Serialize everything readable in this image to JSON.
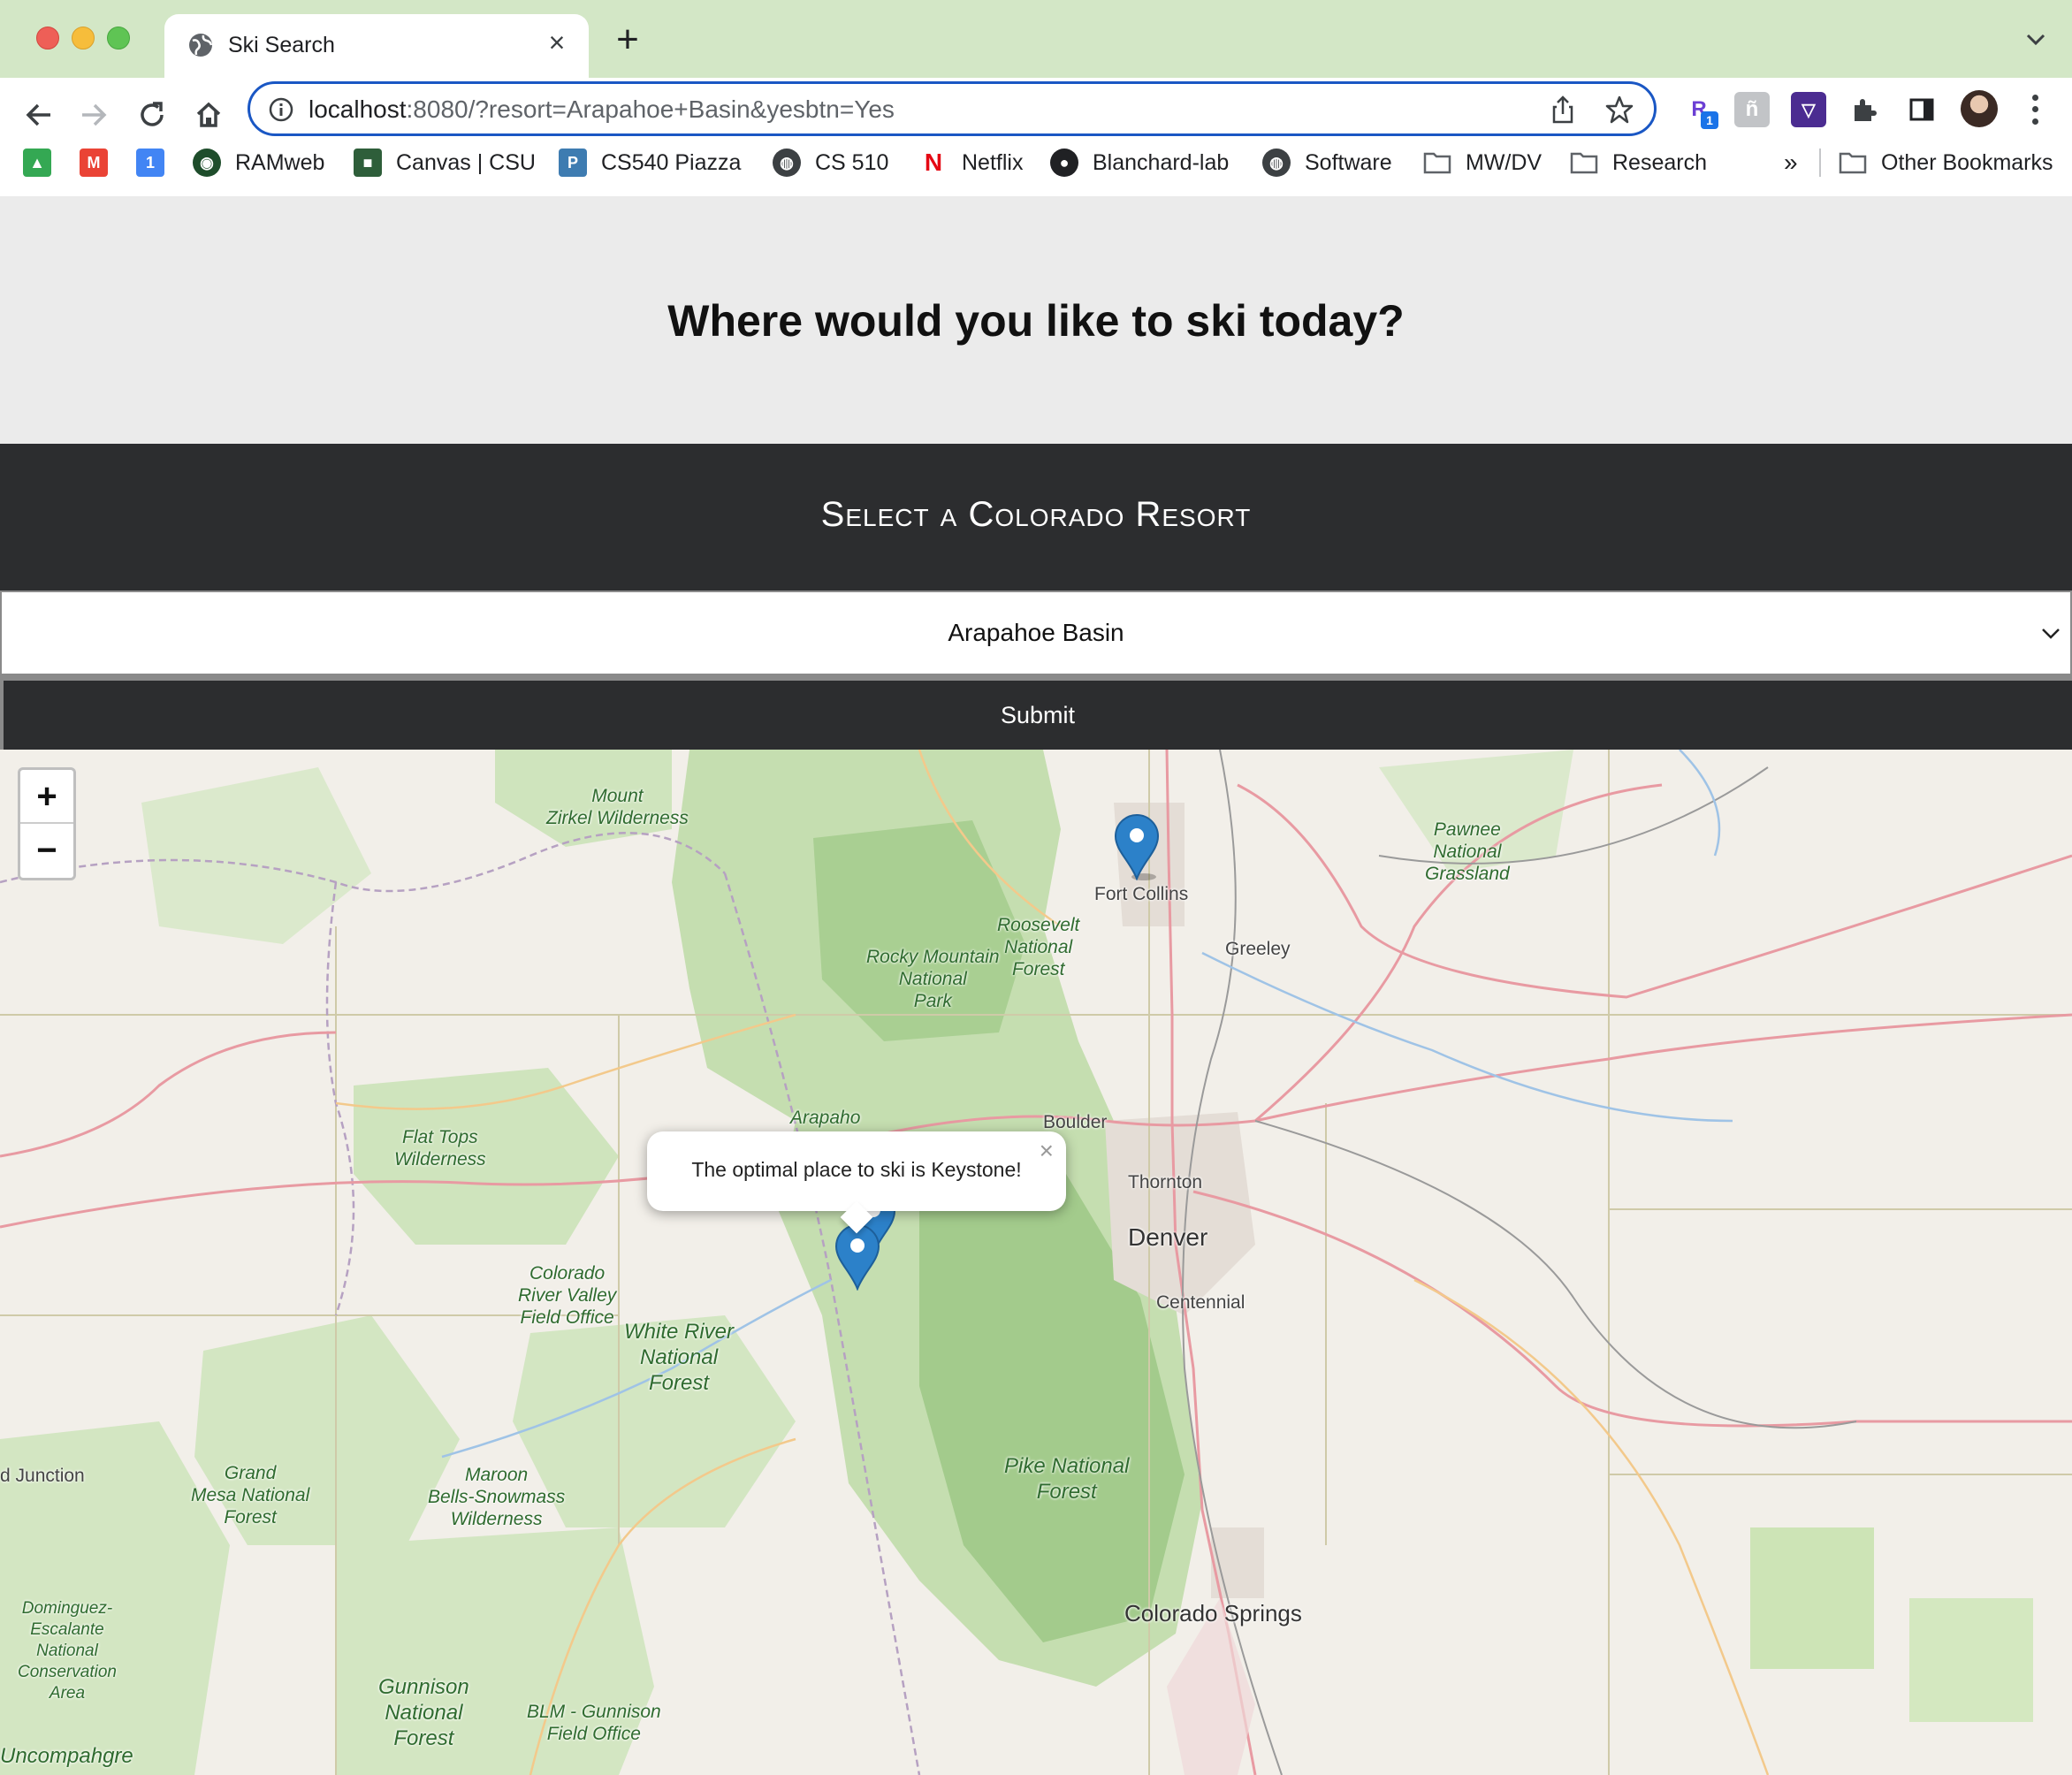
{
  "browser": {
    "tab_title": "Ski Search",
    "url_host": "localhost",
    "url_rest": ":8080/?resort=Arapahoe+Basin&yesbtn=Yes",
    "bookmarks": [
      {
        "label": "",
        "icon": "google-drive-icon",
        "color": "#34a853"
      },
      {
        "label": "",
        "icon": "gmail-icon",
        "color": "#ea4335"
      },
      {
        "label": "",
        "icon": "calendar-icon",
        "color": "#4285f4"
      },
      {
        "label": "RAMweb",
        "icon": "ram-icon",
        "color": "#1e4d2b"
      },
      {
        "label": "Canvas | CSU",
        "icon": "canvas-icon",
        "color": "#2e5e3a"
      },
      {
        "label": "CS540 Piazza",
        "icon": "piazza-icon",
        "color": "#3e7cb1"
      },
      {
        "label": "CS 510",
        "icon": "globe-icon",
        "color": "#3c4043"
      },
      {
        "label": "Netflix",
        "icon": "netflix-icon",
        "color": "#e50914"
      },
      {
        "label": "Blanchard-lab",
        "icon": "github-icon",
        "color": "#202124"
      },
      {
        "label": "Software",
        "icon": "globe-icon",
        "color": "#3c4043"
      },
      {
        "label": "MW/DV",
        "icon": "folder-icon",
        "color": "#5f6368"
      },
      {
        "label": "Research",
        "icon": "folder-icon",
        "color": "#5f6368"
      }
    ],
    "overflow": "»",
    "other_bookmarks": "Other Bookmarks"
  },
  "page": {
    "heading": "Where would you like to ski today?",
    "select_title": "Select a Colorado Resort",
    "selected_resort": "Arapahoe Basin",
    "submit_label": "Submit"
  },
  "map": {
    "zoom_in": "+",
    "zoom_out": "−",
    "popup_text": "The optimal place to ski is Keystone!",
    "popup_close": "×",
    "places": {
      "mount_zirkel": "Mount\nZirkel Wilderness",
      "pawnee": "Pawnee\nNational\nGrassland",
      "roosevelt": "Roosevelt\nNational\nForest",
      "rocky_mountain": "Rocky Mountain\nNational\nPark",
      "flat_tops": "Flat Tops\nWilderness",
      "arapaho": "Arapaho",
      "colorado_river": "Colorado\nRiver Valley\nField Office",
      "white_river": "White River\nNational\nForest",
      "grand_mesa": "Grand\nMesa National\nForest",
      "maroon_bells": "Maroon\nBells-Snowmass\nWilderness",
      "pike": "Pike National\nForest",
      "dominguez": "Dominguez-\nEscalante\nNational\nConservation\nArea",
      "gunnison": "Gunnison\nNational\nForest",
      "blm_gunnison": "BLM - Gunnison\nField Office",
      "uncompahgre": "Uncompahgre"
    },
    "cities": {
      "fort_collins": "Fort Collins",
      "greeley": "Greeley",
      "boulder": "Boulder",
      "thornton": "Thornton",
      "denver": "Denver",
      "centennial": "Centennial",
      "colorado_springs": "Colorado Springs",
      "grand_junction": "d Junction"
    },
    "marker_color": "#2c81c9"
  }
}
